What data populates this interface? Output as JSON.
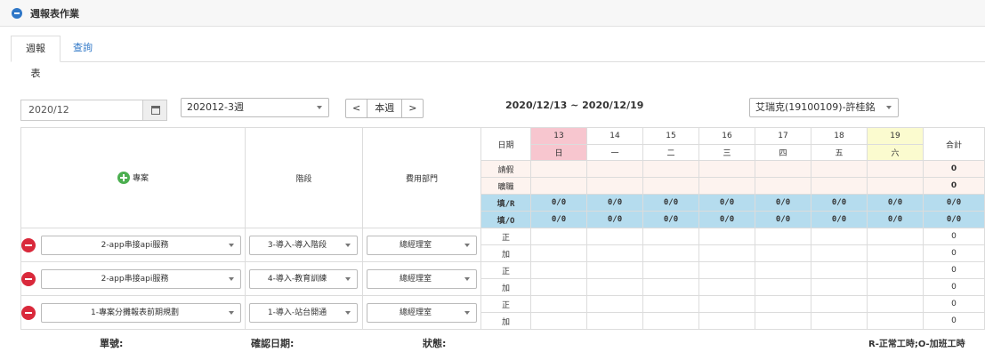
{
  "header": {
    "title": "週報表作業"
  },
  "tabs": [
    {
      "label": "週報表"
    },
    {
      "label": "查詢"
    }
  ],
  "controls": {
    "month": "2020/12",
    "week": "202012-3週",
    "nav_prev": "<",
    "nav_this": "本週",
    "nav_next": ">",
    "date_range": "2020/12/13 ~ 2020/12/19",
    "employee": "艾瑞克(19100109)-許桂銘"
  },
  "table": {
    "col_project": "專案",
    "col_stage": "階段",
    "col_dept": "費用部門",
    "date_label": "日期",
    "total_label": "合計",
    "days": [
      {
        "num": "13",
        "wk": "日"
      },
      {
        "num": "14",
        "wk": "一"
      },
      {
        "num": "15",
        "wk": "二"
      },
      {
        "num": "16",
        "wk": "三"
      },
      {
        "num": "17",
        "wk": "四"
      },
      {
        "num": "18",
        "wk": "五"
      },
      {
        "num": "19",
        "wk": "六"
      }
    ],
    "leave_label": "請假",
    "leave_total": "0",
    "shift_label": "曠職",
    "shift_total": "0",
    "r_label": "填/R",
    "o_label": "填/O",
    "ratio": "0/0",
    "normal_label": "正",
    "overtime_label": "加",
    "rows": [
      {
        "project": "2-app串接api服務",
        "stage": "3-導入-導入階段",
        "dept": "總經理室",
        "total_normal": "0",
        "total_over": "0"
      },
      {
        "project": "2-app串接api服務",
        "stage": "4-導入-教育訓練",
        "dept": "總經理室",
        "total_normal": "0",
        "total_over": "0"
      },
      {
        "project": "1-專案分攤報表前期規劃",
        "stage": "1-導入-站台開通",
        "dept": "總經理室",
        "total_normal": "0",
        "total_over": "0"
      }
    ]
  },
  "footer": {
    "order_no": "單號:",
    "confirm_date": "確認日期:",
    "status": "狀態:",
    "legend": "R-正常工時;O-加班工時"
  },
  "colors": {
    "sunday": "#f7c6cf",
    "saturday": "#fbfbcf",
    "timesheet_blue": "#b5dcee",
    "leave_bg": "#fdf3ef",
    "accent": "#2f77c7"
  }
}
